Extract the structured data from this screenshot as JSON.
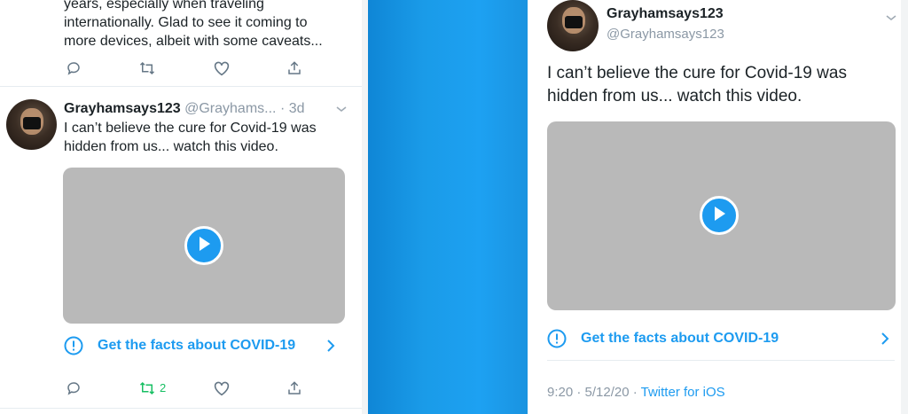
{
  "left": {
    "prev_tweet": {
      "line1": "years, especially when traveling",
      "line2": "internationally. Glad to see it coming to",
      "line3": "more devices, albeit with some caveats..."
    },
    "tweet": {
      "name": "Grayhamsays123",
      "handle": "@Grayhams...",
      "time": "· 3d",
      "text_line1": "I can’t believe the cure for Covid-19 was",
      "text_line2": "hidden from us... watch this video.",
      "facts_label": "Get the facts about COVID-19",
      "retweet_count": "2"
    }
  },
  "right": {
    "tweet": {
      "name": "Grayhamsays123",
      "handle": "@Grayhamsays123",
      "text_line1": "I can’t believe the cure for Covid-19 was",
      "text_line2": "hidden from us... watch this video.",
      "facts_label": "Get the facts about COVID-19",
      "timestamp": "9:20 · 5/12/20 · ",
      "source": "Twitter for iOS"
    }
  },
  "icons": [
    "reply-icon",
    "retweet-icon",
    "like-icon",
    "share-icon",
    "play-icon",
    "info-icon",
    "chevron-right-icon",
    "chevron-down-icon"
  ],
  "colors": {
    "accent": "#1d9bf0",
    "retweet_active": "#17bf63",
    "media_gray": "#b9b9b9",
    "divider_blue": "#1da1f2"
  }
}
